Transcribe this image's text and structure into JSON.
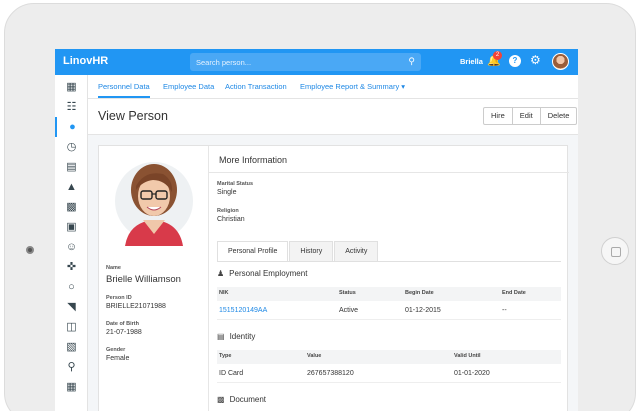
{
  "app": {
    "brand": "LinovHR"
  },
  "search": {
    "placeholder": "Search person...",
    "icon": "search-icon"
  },
  "user": {
    "name": "Briella",
    "notifications": "2"
  },
  "rail": [
    "dashboard-icon",
    "org-chart-icon",
    "person-icon",
    "clock-icon",
    "money-icon",
    "bank-icon",
    "document-icon",
    "briefcase-icon",
    "team-icon",
    "person-stand-icon",
    "bulb-icon",
    "chart-icon",
    "presentation-icon",
    "id-card-icon",
    "search-plus-icon",
    "building-icon"
  ],
  "subnav": {
    "tabs": [
      "Personnel Data",
      "Employee Data",
      "Action Transaction",
      "Employee Report & Summary ▾"
    ]
  },
  "page": {
    "title": "View Person",
    "buttons": [
      "Hire",
      "Edit",
      "Delete"
    ]
  },
  "person": {
    "name_label": "Name",
    "name": "Brielle Williamson",
    "id_label": "Person ID",
    "id": "BRIELLE21071988",
    "dob_label": "Date of Birth",
    "dob": "21-07-1988",
    "gender_label": "Gender",
    "gender": "Female"
  },
  "more": {
    "title": "More Information",
    "marital_label": "Marital Status",
    "marital": "Single",
    "religion_label": "Religion",
    "religion": "Christian"
  },
  "profile_tabs": [
    "Personal Profile",
    "History",
    "Activity"
  ],
  "employment": {
    "title": "Personal Employment",
    "columns": [
      "NIK",
      "Status",
      "Begin Date",
      "End Date"
    ],
    "row": [
      "1515120149AA",
      "Active",
      "01-12-2015",
      "--"
    ]
  },
  "identity": {
    "title": "Identity",
    "columns": [
      "Type",
      "Value",
      "Valid Until"
    ],
    "row": [
      "ID Card",
      "267657388120",
      "01-01-2020"
    ]
  },
  "document": {
    "title": "Document"
  },
  "colors": {
    "primary": "#2196f3",
    "link": "#1e88e5",
    "badge": "#f44336"
  }
}
